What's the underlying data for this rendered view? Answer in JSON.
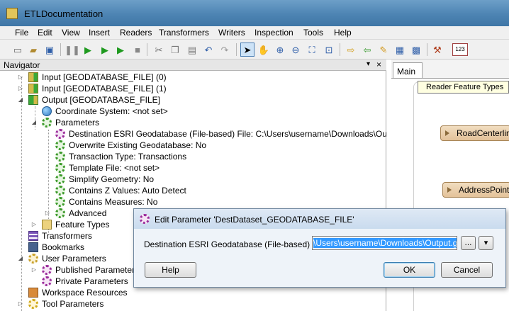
{
  "window": {
    "title": "ETLDocumentation"
  },
  "menu": [
    "File",
    "Edit",
    "View",
    "Insert",
    "Readers",
    "Transformers",
    "Writers",
    "Inspection",
    "Tools",
    "Help"
  ],
  "toolbar_icons": [
    "new-icon",
    "open-icon",
    "save-icon",
    "pause-icon",
    "run-icon",
    "run-to-icon",
    "run-stop-icon",
    "stop-icon",
    "cut-icon",
    "copy-icon",
    "paste-icon",
    "undo-icon",
    "redo-icon",
    "select-icon",
    "pan-icon",
    "zoom-in-icon",
    "zoom-out-icon",
    "zoom-extents-icon",
    "zoom-selected-icon",
    "add-reader-icon",
    "add-writer-icon",
    "annotation-icon",
    "bookmark-icon",
    "transformer-gallery-icon",
    "tool-icon",
    "feature-count-icon"
  ],
  "navigator": {
    "title": "Navigator",
    "pin": "▾",
    "close": "×",
    "items": [
      {
        "label": "Input [GEODATABASE_FILE] (0)"
      },
      {
        "label": "Input [GEODATABASE_FILE] (1)"
      },
      {
        "label": "Output [GEODATABASE_FILE]"
      },
      {
        "label": "Coordinate System: <not set>"
      },
      {
        "label": "Parameters"
      },
      {
        "label": "Destination ESRI Geodatabase (File-based) File: C:\\Users\\username\\Downloads\\Output.gdb"
      },
      {
        "label": "Overwrite Existing Geodatabase: No"
      },
      {
        "label": "Transaction Type: Transactions"
      },
      {
        "label": "Template File: <not set>"
      },
      {
        "label": "Simplify Geometry: No"
      },
      {
        "label": "Contains Z Values: Auto Detect"
      },
      {
        "label": "Contains Measures: No"
      },
      {
        "label": "Advanced"
      },
      {
        "label": "Feature Types"
      },
      {
        "label": "Transformers"
      },
      {
        "label": "Bookmarks"
      },
      {
        "label": "User Parameters"
      },
      {
        "label": "Published Parameters"
      },
      {
        "label": "Private Parameters"
      },
      {
        "label": "Workspace Resources"
      },
      {
        "label": "Tool Parameters"
      }
    ]
  },
  "canvas": {
    "tab": "Main",
    "tooltip": "Reader Feature Types",
    "nodes": [
      "RoadCenterlin...",
      "AddressPoint [I"
    ]
  },
  "dialog": {
    "title": "Edit Parameter 'DestDataset_GEODATABASE_FILE'",
    "label": "Destination ESRI Geodatabase (File-based) File:",
    "value": "\\Users\\username\\Downloads\\Output.gdb",
    "browse": "...",
    "dropdown": "▾",
    "help": "Help",
    "ok": "OK",
    "cancel": "Cancel"
  }
}
